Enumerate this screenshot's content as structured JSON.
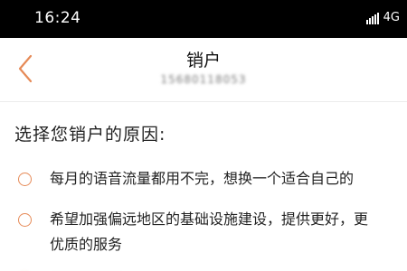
{
  "status_bar": {
    "time": "16:24",
    "network": "4G",
    "icons": [
      "signal-bars-icon",
      "network-4g-icon"
    ]
  },
  "header": {
    "title": "销户",
    "account_number_masked": "15680118053",
    "back_icon": "chevron-left-icon"
  },
  "section": {
    "title": "选择您销户的原因:"
  },
  "options": [
    {
      "label": "每月的语音流量都用不完，想换一个适合自己的",
      "selected": false
    },
    {
      "label_line1": "希望加强偏远地区的基础设施建设，提供更好，更",
      "label_line2": "优质的服务",
      "selected": false
    }
  ],
  "colors": {
    "accent": "#e68a57",
    "status_bar_bg": "#000000",
    "text_primary": "#222222",
    "text_secondary": "#7a7a7a"
  }
}
